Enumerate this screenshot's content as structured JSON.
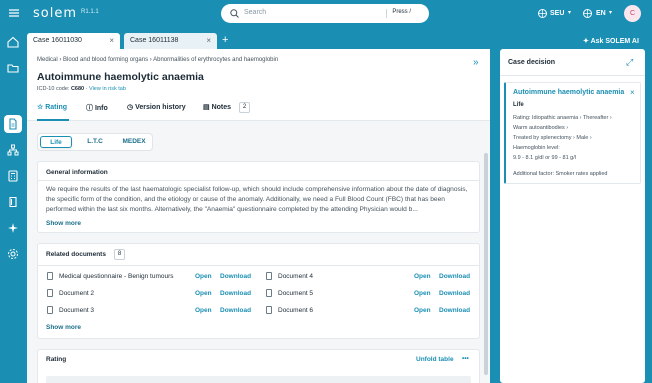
{
  "app": {
    "logo": "solem",
    "version": "R1.1.1"
  },
  "search": {
    "placeholder": "Search",
    "shortcut": "Press /"
  },
  "topbar": {
    "region": "SEU",
    "language": "EN",
    "avatar_initial": "C"
  },
  "tabs": [
    {
      "label": "Case 16011030"
    },
    {
      "label": "Case 16011138"
    }
  ],
  "ask_ai": "Ask SOLEM AI",
  "case": {
    "breadcrumb": [
      "Medical",
      "Blood and blood forming organs",
      "Abnormalities of erythrocytes and haemoglobin"
    ],
    "title": "Autoimmune haemolytic anaemia",
    "icd_label": "ICD-10 code:",
    "icd_code": "C680",
    "risk_link": "View in risk tab",
    "subtabs": [
      "Rating",
      "Info",
      "Version history",
      "Notes"
    ],
    "notes_count": "2"
  },
  "segments": [
    "Life",
    "L.T.C",
    "MEDEX"
  ],
  "general_info": {
    "title": "General information",
    "text": "We require the results of the last haematologic specialist follow-up, which should include comprehensive information about the date of diagnosis, the specific form of the condition, and the etiology or cause of the anomaly. Additionally, we need a Full Blood Count (FBC) that has been performed within the last six months. Alternatively, the \"Anaemia\" questionnaire completed by the attending Physician would b...",
    "show_more": "Show more"
  },
  "related_docs": {
    "title": "Related documents",
    "count": "8",
    "open": "Open",
    "download": "Download",
    "left": [
      "Medical questionnaire - Benign tumours",
      "Document 2",
      "Document 3"
    ],
    "right": [
      "Document 4",
      "Document 5",
      "Document 6"
    ],
    "show_more": "Show more"
  },
  "rating": {
    "title": "Rating",
    "unfold": "Unfold table",
    "more": "•••"
  },
  "decision": {
    "title": "Case decision",
    "name": "Autoimmune haemolytic anaemia",
    "product": "Life",
    "lines": [
      "Rating: Idiopathic anaemia ›  Thereafter ›",
      "Warm autoantibodies ›",
      "Treated by splenectomy ›  Male ›",
      "Haemoglobin level:",
      "9.9 - 8.1 g/dl or 99 - 81 g/l"
    ],
    "additional": "Additional factor: Smoker rates applied"
  }
}
